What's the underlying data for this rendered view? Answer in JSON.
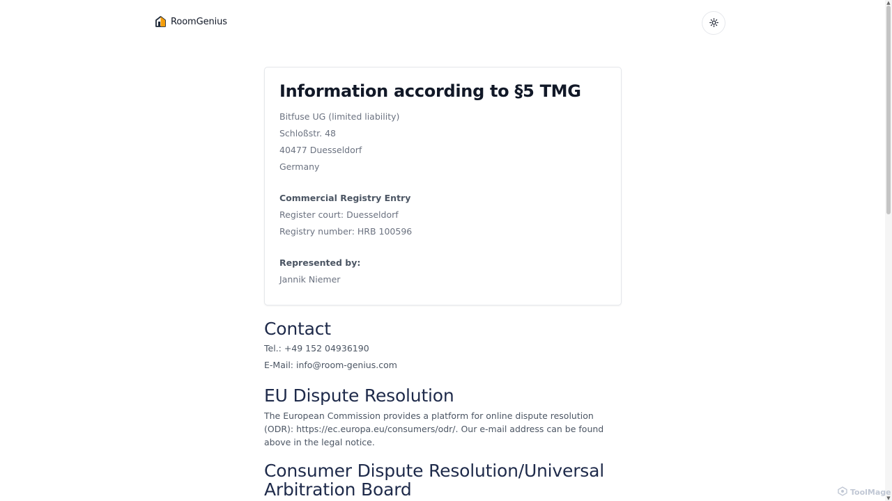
{
  "header": {
    "brand_name": "RoomGenius",
    "logo_icon": "house-logo-icon",
    "theme_toggle_icon": "sun-icon"
  },
  "card": {
    "title": "Information according to §5 TMG",
    "address": [
      "Bitfuse UG (limited liability)",
      "Schloßstr. 48",
      "40477 Duesseldorf",
      "Germany"
    ],
    "registry_heading": "Commercial Registry Entry",
    "register_court": "Register court: Duesseldorf",
    "registry_number": "Registry number: HRB 100596",
    "represented_heading": "Represented by:",
    "representative": "Jannik Niemer"
  },
  "contact": {
    "heading": "Contact",
    "tel": "Tel.: +49 152 04936190",
    "email_prefix": "E-Mail: ",
    "email": "info@room-genius.com"
  },
  "eu_dispute": {
    "heading": "EU Dispute Resolution",
    "text_before": "The European Commission provides a platform for online dispute resolution (ODR):",
    "url": "https://ec.europa.eu/consumers/odr/",
    "text_after": ". Our e-mail address can be found above in the legal notice."
  },
  "consumer_dispute": {
    "heading_line1": "Consumer Dispute Resolution/Universal",
    "heading_line2": "Arbitration Board"
  },
  "watermark": "ToolMage",
  "colors": {
    "heading": "#1e2a4a",
    "body_text": "#4b5563",
    "muted_text": "#6b7280",
    "border": "#e5e7eb",
    "logo_accent": "#f59e0b"
  }
}
